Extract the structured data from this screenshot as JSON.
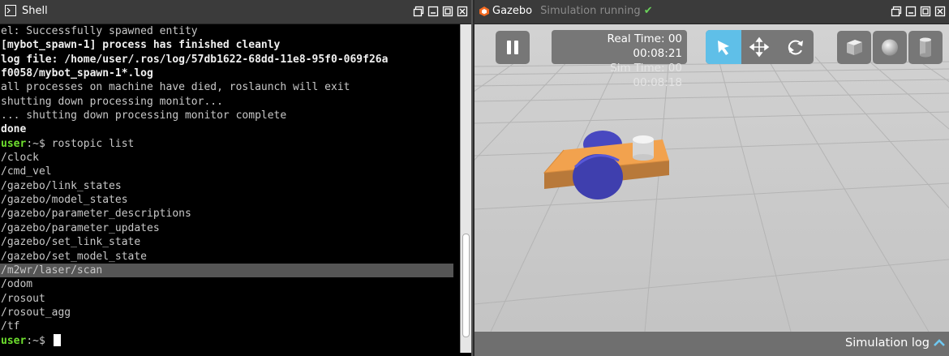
{
  "shell": {
    "title": "Shell",
    "lines": [
      {
        "text": "el: Successfully spawned entity",
        "style": "normal"
      },
      {
        "text": "[mybot_spawn-1] process has finished cleanly",
        "style": "bold"
      },
      {
        "text": "log file: /home/user/.ros/log/57db1622-68dd-11e8-95f0-069f26a",
        "style": "bold"
      },
      {
        "text": "f0058/mybot_spawn-1*.log",
        "style": "bold"
      },
      {
        "text": "all processes on machine have died, roslaunch will exit",
        "style": "normal"
      },
      {
        "text": "shutting down processing monitor...",
        "style": "normal"
      },
      {
        "text": "... shutting down processing monitor complete",
        "style": "normal"
      },
      {
        "text": "done",
        "style": "bold"
      },
      {
        "text": "",
        "style": "prompt",
        "prompt_user": "user",
        "prompt_rest": ":~$ ",
        "command": "rostopic list"
      },
      {
        "text": "/clock",
        "style": "normal"
      },
      {
        "text": "/cmd_vel",
        "style": "normal"
      },
      {
        "text": "/gazebo/link_states",
        "style": "normal"
      },
      {
        "text": "/gazebo/model_states",
        "style": "normal"
      },
      {
        "text": "/gazebo/parameter_descriptions",
        "style": "normal"
      },
      {
        "text": "/gazebo/parameter_updates",
        "style": "normal"
      },
      {
        "text": "/gazebo/set_link_state",
        "style": "normal"
      },
      {
        "text": "/gazebo/set_model_state",
        "style": "normal"
      },
      {
        "text": "/m2wr/laser/scan",
        "style": "selected"
      },
      {
        "text": "/odom",
        "style": "normal"
      },
      {
        "text": "/rosout",
        "style": "normal"
      },
      {
        "text": "/rosout_agg",
        "style": "normal"
      },
      {
        "text": "/tf",
        "style": "normal"
      },
      {
        "text": "",
        "style": "prompt-cursor",
        "prompt_user": "user",
        "prompt_rest": ":~$ ",
        "command": ""
      }
    ]
  },
  "gazebo": {
    "title": "Gazebo",
    "status": "Simulation running",
    "real_time_label": "Real Time: 00",
    "real_time_value": "00:08:21",
    "sim_time_label": "Sim Time: 00",
    "sim_time_value": "00:08:18",
    "tools": [
      "select-tool",
      "translate-tool",
      "rotate-tool"
    ],
    "active_tool": "select-tool",
    "shapes": [
      "box",
      "sphere",
      "cylinder"
    ],
    "log_label": "Simulation log"
  },
  "colors": {
    "prompt_green": "#6ee02e",
    "active_tool": "#5fbfe8",
    "robot_body": "#f5a04a",
    "robot_wheel": "#3c3caa",
    "ground": "#c7c7c7"
  }
}
